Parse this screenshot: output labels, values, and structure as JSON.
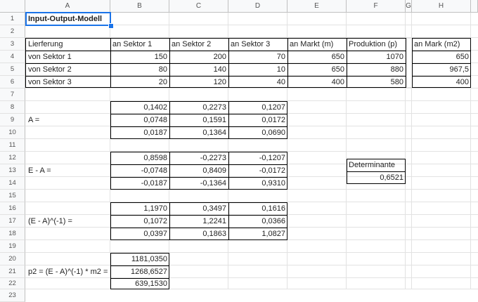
{
  "columns": [
    "A",
    "B",
    "C",
    "D",
    "E",
    "F",
    "G",
    "H"
  ],
  "rows": [
    "1",
    "2",
    "3",
    "4",
    "5",
    "6",
    "7",
    "8",
    "9",
    "10",
    "11",
    "12",
    "13",
    "14",
    "15",
    "16",
    "17",
    "18",
    "19",
    "20",
    "21",
    "22",
    "23"
  ],
  "title": "Input-Output-Modell",
  "header_row": {
    "a": "Lierferung",
    "b": "an Sektor 1",
    "c": "an Sektor 2",
    "d": "an Sektor 3",
    "e": "an Markt (m)",
    "f": "Produktion (p)",
    "h": "an Mark (m2)"
  },
  "sectors": [
    {
      "label": "von Sektor 1",
      "b": "150",
      "c": "200",
      "d": "70",
      "e": "650",
      "f": "1070",
      "h": "650"
    },
    {
      "label": "von Sektor 2",
      "b": "80",
      "c": "140",
      "d": "10",
      "e": "650",
      "f": "880",
      "h": "967,5"
    },
    {
      "label": "von Sektor 3",
      "b": "20",
      "c": "120",
      "d": "40",
      "e": "400",
      "f": "580",
      "h": "400"
    }
  ],
  "matrix_a": {
    "label": "A =",
    "rows": [
      [
        "0,1402",
        "0,2273",
        "0,1207"
      ],
      [
        "0,0748",
        "0,1591",
        "0,0172"
      ],
      [
        "0,0187",
        "0,1364",
        "0,0690"
      ]
    ]
  },
  "matrix_ea": {
    "label": "E - A =",
    "rows": [
      [
        "0,8598",
        "-0,2273",
        "-0,1207"
      ],
      [
        "-0,0748",
        "0,8409",
        "-0,0172"
      ],
      [
        "-0,0187",
        "-0,1364",
        "0,9310"
      ]
    ]
  },
  "determinant": {
    "label": "Determinante",
    "value": "0,6521"
  },
  "matrix_inv": {
    "label": "(E - A)^(-1) =",
    "rows": [
      [
        "1,1970",
        "0,3497",
        "0,1616"
      ],
      [
        "0,1072",
        "1,2241",
        "0,0366"
      ],
      [
        "0,0397",
        "0,1863",
        "1,0827"
      ]
    ]
  },
  "p2": {
    "label": "p2 = (E - A)^(-1) * m2 =",
    "values": [
      "1181,0350",
      "1268,6527",
      "639,1530"
    ]
  },
  "selection_color": "#1a73e8"
}
